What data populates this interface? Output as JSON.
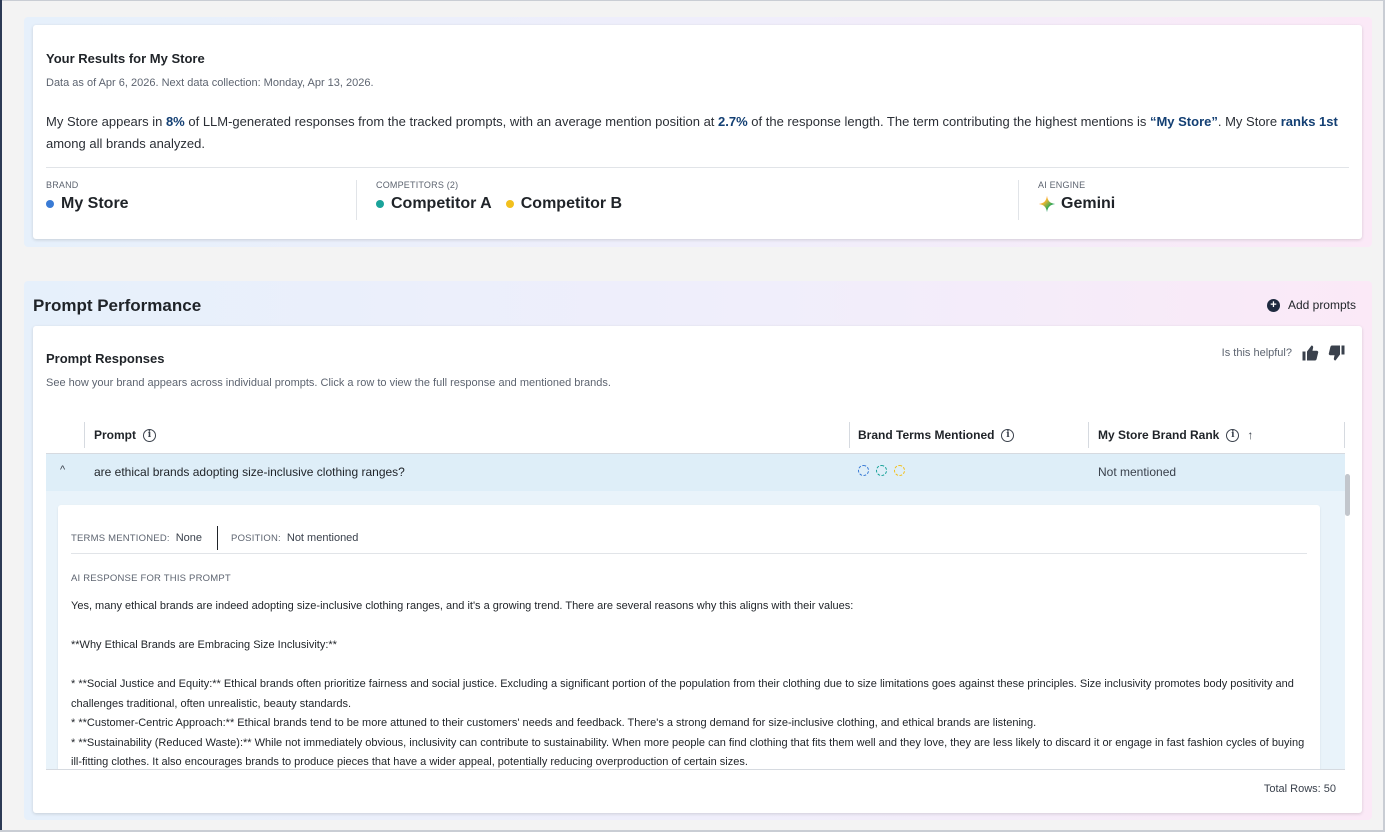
{
  "results": {
    "title": "Your Results for My Store",
    "subtitle": "Data as of Apr 6, 2026. Next data collection: Monday, Apr 13, 2026.",
    "summary": {
      "p1": "My Store appears in ",
      "pct": "8%",
      "p2": " of LLM-generated responses from the tracked prompts, with an average mention position at ",
      "pos": "2.7%",
      "p3": " of the response length. The term contributing the highest mentions is ",
      "term": "“My Store”",
      "p4": ". My Store ",
      "rank": "ranks 1st",
      "p5": " among all brands analyzed."
    },
    "brand": {
      "label": "BRAND",
      "name": "My Store",
      "color": "#3a7bd5"
    },
    "competitors": {
      "label": "COMPETITORS (2)",
      "items": [
        {
          "name": "Competitor A",
          "color": "#1aa39a"
        },
        {
          "name": "Competitor B",
          "color": "#f2c01d"
        }
      ]
    },
    "engine": {
      "label": "AI ENGINE",
      "name": "Gemini",
      "icon": "gemini-sparkle-icon"
    }
  },
  "performance": {
    "title": "Prompt Performance",
    "add_label": "Add prompts",
    "responses_title": "Prompt Responses",
    "responses_subtitle": "See how your brand appears across individual prompts. Click a row to view the full response and mentioned brands.",
    "helpful_label": "Is this helpful?",
    "columns": {
      "prompt": "Prompt",
      "terms": "Brand Terms Mentioned",
      "rank": "My Store Brand Rank"
    },
    "row": {
      "prompt": "are ethical brands adopting size-inclusive clothing ranges?",
      "term_colors": [
        "#3a7bd5",
        "#1aa39a",
        "#f2c01d"
      ],
      "rank": "Not mentioned"
    },
    "detail": {
      "terms_label": "TERMS MENTIONED:",
      "terms_value": "None",
      "position_label": "POSITION:",
      "position_value": "Not mentioned",
      "ai_label": "AI RESPONSE FOR THIS PROMPT",
      "lines": {
        "l1": "Yes, many ethical brands are indeed adopting size-inclusive clothing ranges, and it's a growing trend. There are several reasons why this aligns with their values:",
        "l2": "**Why Ethical Brands are Embracing Size Inclusivity:**",
        "l3": "*   **Social Justice and Equity:** Ethical brands often prioritize fairness and social justice. Excluding a significant portion of the population from their clothing due to size limitations goes against these principles. Size inclusivity promotes body positivity and challenges traditional, often unrealistic, beauty standards.",
        "l4": "*   **Customer-Centric Approach:** Ethical brands tend to be more attuned to their customers' needs and feedback. There's a strong demand for size-inclusive clothing, and ethical brands are listening.",
        "l5": "*   **Sustainability (Reduced Waste):** While not immediately obvious, inclusivity can contribute to sustainability. When more people can find clothing that fits them well and they love, they are less likely to discard it or engage in fast fashion cycles of buying ill-fitting clothes. It also encourages brands to produce pieces that have a wider appeal, potentially reducing overproduction of certain sizes."
      }
    },
    "total_rows": "Total Rows: 50"
  }
}
